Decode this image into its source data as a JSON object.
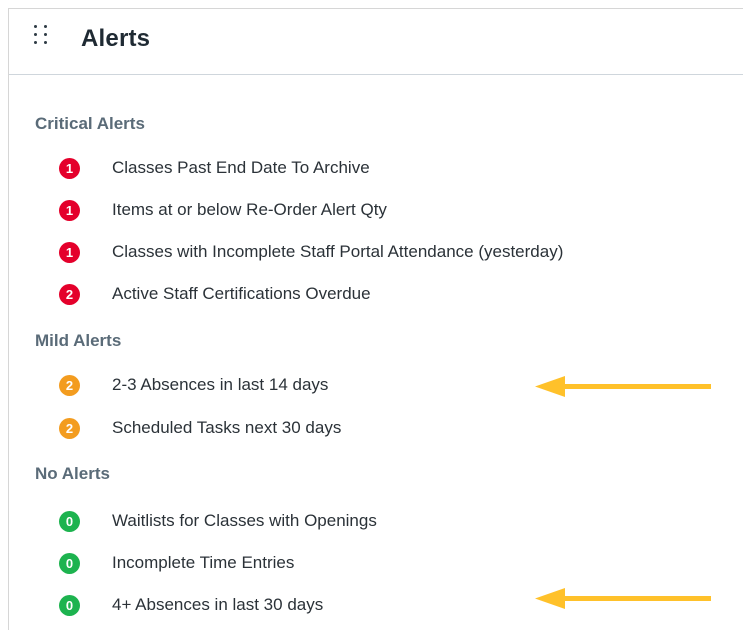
{
  "header": {
    "title": "Alerts",
    "drag_icon": "drag-handle-icon"
  },
  "colors": {
    "critical": "#e4002b",
    "mild": "#f39c1f",
    "none": "#1db34f",
    "annotation_arrow": "#ffc12a"
  },
  "sections": {
    "critical": {
      "title": "Critical Alerts",
      "items": [
        {
          "count": "1",
          "label": "Classes Past End Date To Archive"
        },
        {
          "count": "1",
          "label": "Items at or below Re-Order Alert Qty"
        },
        {
          "count": "1",
          "label": "Classes with Incomplete Staff Portal Attendance (yesterday)"
        },
        {
          "count": "2",
          "label": "Active Staff Certifications Overdue"
        }
      ]
    },
    "mild": {
      "title": "Mild Alerts",
      "items": [
        {
          "count": "2",
          "label": "2-3 Absences in last 14 days"
        },
        {
          "count": "2",
          "label": "Scheduled Tasks next 30 days"
        }
      ]
    },
    "none": {
      "title": "No Alerts",
      "items": [
        {
          "count": "0",
          "label": "Waitlists for Classes with Openings"
        },
        {
          "count": "0",
          "label": "Incomplete Time Entries"
        },
        {
          "count": "0",
          "label": "4+ Absences in last 30 days"
        }
      ]
    }
  }
}
